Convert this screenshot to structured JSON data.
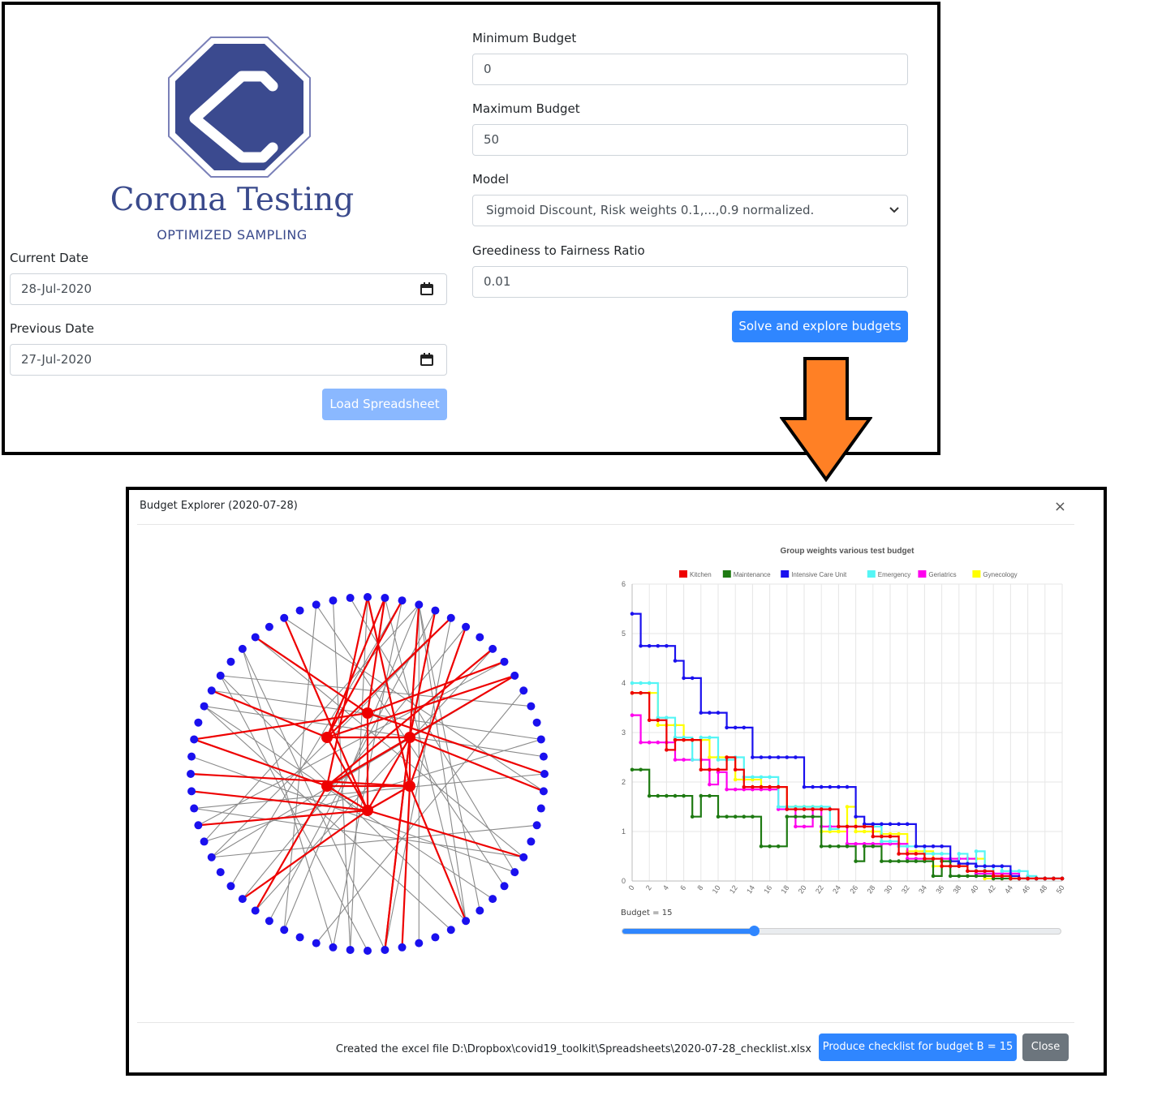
{
  "brand": {
    "title": "Corona Testing",
    "subtitle": "OPTIMIZED SAMPLING"
  },
  "form": {
    "current_date_label": "Current Date",
    "current_date": "28-Jul-2020",
    "previous_date_label": "Previous Date",
    "previous_date": "27-Jul-2020",
    "load_button": "Load Spreadsheet",
    "min_budget_label": "Minimum Budget",
    "min_budget": "0",
    "max_budget_label": "Maximum Budget",
    "max_budget": "50",
    "model_label": "Model",
    "model_selected": "Sigmoid Discount, Risk weights 0.1,...,0.9 normalized.",
    "ratio_label": "Greediness to Fairness Ratio",
    "ratio": "0.01",
    "solve_button": "Solve and explore budgets"
  },
  "colors": {
    "primary": "#2f86ff",
    "arrow": "#ff8025",
    "brand": "#3a4a8c",
    "node_blue": "#1a10ee",
    "node_red": "#ee0000"
  },
  "modal": {
    "title": "Budget Explorer (2020-07-28)",
    "close_icon": "×",
    "budget_label": "Budget = 15",
    "budget_value": 15,
    "budget_max": 50,
    "footer_message": "Created the excel file D:\\Dropbox\\covid19_toolkit\\Spreadsheets\\2020-07-28_checklist.xlsx",
    "checklist_button": "Produce checklist for budget B = 15",
    "close_button": "Close"
  },
  "chart_data": {
    "type": "line",
    "title": "Group weights various test budget",
    "x": [
      0,
      1,
      2,
      3,
      4,
      5,
      6,
      7,
      8,
      9,
      10,
      11,
      12,
      13,
      14,
      15,
      16,
      17,
      18,
      19,
      20,
      21,
      22,
      23,
      24,
      25,
      26,
      27,
      28,
      29,
      30,
      31,
      32,
      33,
      34,
      35,
      36,
      37,
      38,
      39,
      40,
      41,
      42,
      43,
      44,
      45,
      46,
      47,
      48,
      49,
      50
    ],
    "xticks": [
      "0",
      "2",
      "4",
      "6",
      "8",
      "10",
      "12",
      "14",
      "16",
      "18",
      "20",
      "22",
      "24",
      "26",
      "28",
      "30",
      "32",
      "34",
      "36",
      "38",
      "40",
      "42",
      "44",
      "46",
      "48",
      "50"
    ],
    "ylim": [
      0,
      6
    ],
    "yticks": [
      "0",
      "1",
      "2",
      "3",
      "4",
      "5",
      "6"
    ],
    "series": [
      {
        "name": "Kitchen",
        "color": "#ee0000",
        "values": [
          3.8,
          3.8,
          3.25,
          3.25,
          2.65,
          2.85,
          2.85,
          2.85,
          2.25,
          2.25,
          2.25,
          2.5,
          2.25,
          1.9,
          1.9,
          1.9,
          1.9,
          1.9,
          1.45,
          1.45,
          1.45,
          1.45,
          1.45,
          1.45,
          1.1,
          1.1,
          1.1,
          1.1,
          0.9,
          0.9,
          0.9,
          0.55,
          0.55,
          0.55,
          0.45,
          0.45,
          0.3,
          0.3,
          0.3,
          0.2,
          0.2,
          0.2,
          0.1,
          0.1,
          0.05,
          0.05,
          0.05,
          0.05,
          0.05,
          0.05,
          0.05
        ]
      },
      {
        "name": "Maintenance",
        "color": "#1e7a12",
        "values": [
          2.25,
          2.25,
          1.72,
          1.72,
          1.72,
          1.72,
          1.72,
          1.3,
          1.72,
          1.72,
          1.3,
          1.3,
          1.3,
          1.3,
          1.3,
          0.7,
          0.7,
          0.7,
          1.3,
          1.3,
          1.3,
          1.3,
          0.7,
          0.7,
          0.7,
          0.7,
          0.4,
          0.7,
          0.7,
          0.4,
          0.4,
          0.4,
          0.4,
          0.4,
          0.4,
          0.1,
          0.4,
          0.1,
          0.1,
          0.1,
          0.1,
          0.1,
          0.05,
          0.05,
          0.05,
          0.05,
          0.05,
          0.05,
          0.05,
          0.05,
          0.05
        ]
      },
      {
        "name": "Intensive Care Unit",
        "color": "#1a10ee",
        "values": [
          5.4,
          4.75,
          4.75,
          4.75,
          4.75,
          4.45,
          4.1,
          4.1,
          3.4,
          3.4,
          3.4,
          3.1,
          3.1,
          3.1,
          2.5,
          2.5,
          2.5,
          2.5,
          2.5,
          2.5,
          1.9,
          1.9,
          1.9,
          1.9,
          1.9,
          1.9,
          1.3,
          1.15,
          1.15,
          1.15,
          1.15,
          1.15,
          1.15,
          0.7,
          0.7,
          0.7,
          0.7,
          0.4,
          0.35,
          0.35,
          0.3,
          0.3,
          0.3,
          0.3,
          0.1,
          0.05,
          0.05,
          0.05,
          0.05,
          0.05,
          0.05
        ]
      },
      {
        "name": "Emergency",
        "color": "#55f5f5",
        "values": [
          4.0,
          4.0,
          4.0,
          3.3,
          3.3,
          2.9,
          2.9,
          2.45,
          2.9,
          2.9,
          2.45,
          2.45,
          2.5,
          2.1,
          2.1,
          2.1,
          2.1,
          1.5,
          1.5,
          1.5,
          1.5,
          1.5,
          1.5,
          1.05,
          1.1,
          1.1,
          1.1,
          1.1,
          1.1,
          0.8,
          0.8,
          0.7,
          0.7,
          0.7,
          0.55,
          0.55,
          0.55,
          0.3,
          0.55,
          0.2,
          0.6,
          0.2,
          0.3,
          0.2,
          0.2,
          0.2,
          0.1,
          0.05,
          0.05,
          0.05,
          0.05
        ]
      },
      {
        "name": "Geriatrics",
        "color": "#ff00ee",
        "values": [
          3.35,
          2.8,
          2.8,
          2.8,
          2.8,
          2.45,
          2.45,
          2.45,
          2.45,
          1.95,
          2.2,
          1.85,
          1.85,
          1.85,
          1.85,
          1.85,
          1.85,
          1.45,
          1.45,
          1.1,
          1.1,
          1.45,
          1.1,
          1.1,
          1.1,
          0.75,
          0.75,
          0.75,
          0.75,
          0.75,
          0.75,
          0.75,
          0.45,
          0.45,
          0.45,
          0.45,
          0.45,
          0.45,
          0.45,
          0.45,
          0.15,
          0.15,
          0.15,
          0.15,
          0.15,
          0.05,
          0.05,
          0.05,
          0.05,
          0.05,
          0.05
        ]
      },
      {
        "name": "Gynecology",
        "color": "#ffff00",
        "values": [
          3.8,
          3.8,
          3.8,
          3.15,
          3.15,
          3.15,
          2.85,
          2.85,
          2.85,
          2.5,
          2.5,
          2.5,
          2.05,
          2.05,
          2.05,
          1.9,
          1.9,
          1.9,
          1.5,
          1.5,
          1.5,
          1.5,
          1.0,
          1.0,
          1.0,
          1.5,
          1.0,
          1.0,
          1.0,
          0.95,
          0.95,
          0.95,
          0.6,
          0.6,
          0.6,
          0.3,
          0.3,
          0.3,
          0.3,
          0.45,
          0.45,
          0.05,
          0.05,
          0.05,
          0.05,
          0.05,
          0.05,
          0.05,
          0.05,
          0.05,
          0.05
        ]
      }
    ]
  }
}
